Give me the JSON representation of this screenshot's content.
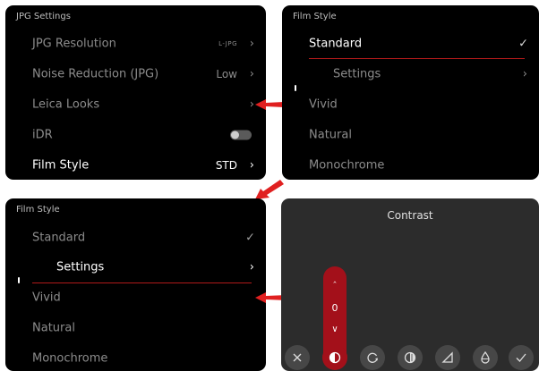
{
  "panel1": {
    "header": "JPG Settings",
    "rows": [
      {
        "label": "JPG Resolution",
        "value": "L-JPG"
      },
      {
        "label": "Noise Reduction (JPG)",
        "value": "Low"
      },
      {
        "label": "Leica Looks",
        "value": ""
      },
      {
        "label": "iDR",
        "value": ""
      },
      {
        "label": "Film Style",
        "value": "STD"
      }
    ]
  },
  "panel2": {
    "header": "Film Style",
    "rows": [
      {
        "label": "Standard"
      },
      {
        "label": "Settings"
      },
      {
        "label": "Vivid"
      },
      {
        "label": "Natural"
      },
      {
        "label": "Monochrome"
      }
    ]
  },
  "panel3": {
    "header": "Film Style",
    "rows": [
      {
        "label": "Standard"
      },
      {
        "label": "Settings"
      },
      {
        "label": "Vivid"
      },
      {
        "label": "Natural"
      },
      {
        "label": "Monochrome"
      }
    ]
  },
  "panel4": {
    "title": "Contrast",
    "value": "0",
    "icons": [
      "close-icon",
      "contrast-icon",
      "rotate-icon",
      "saturation-icon",
      "sharpness-icon",
      "tint-icon",
      "confirm-icon"
    ]
  },
  "colors": {
    "accent": "#a3101a",
    "arrow": "#e02020",
    "screen": "#000000"
  }
}
